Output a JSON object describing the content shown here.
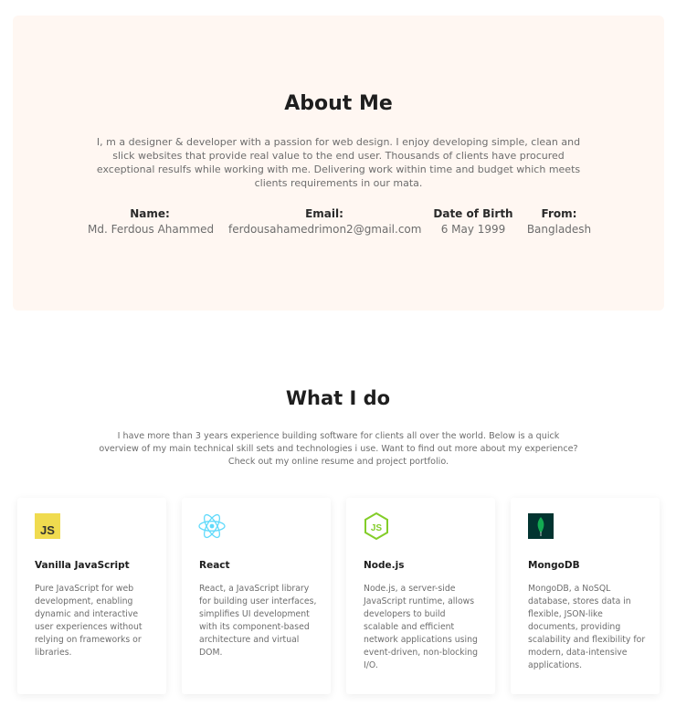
{
  "about": {
    "title": "About Me",
    "description": "I, m a designer & developer with a passion for web design. I enjoy developing simple, clean and slick websites that provide real value to the end user. Thousands of clients have procured exceptional resulfs while working with me. Delivering work within time and budget which meets clients requirements in our mata.",
    "info": [
      {
        "label": "Name:",
        "value": "Md. Ferdous Ahammed"
      },
      {
        "label": "Email:",
        "value": "ferdousahamedrimon2@gmail.com"
      },
      {
        "label": "Date of Birth",
        "value": "6 May 1999"
      },
      {
        "label": "From:",
        "value": "Bangladesh"
      }
    ]
  },
  "services": {
    "title": "What I do",
    "description": "I have more than 3 years experience building software for clients all over the world. Below is a quick overview of my main technical skill sets and technologies i use. Want to find out more about my experience? Check out my online resume and project portfolio.",
    "cards": [
      {
        "icon": "javascript-icon",
        "icon_text": "JS",
        "title": "Vanilla JavaScript",
        "description": "Pure JavaScript for web development, enabling dynamic and interactive user experiences without relying on frameworks or libraries."
      },
      {
        "icon": "react-icon",
        "title": "React",
        "description": "React, a JavaScript library for building user interfaces, simplifies UI development with its component-based architecture and virtual DOM."
      },
      {
        "icon": "nodejs-icon",
        "icon_text": "JS",
        "title": "Node.js",
        "description": "Node.js, a server-side JavaScript runtime, allows developers to build scalable and efficient network applications using event-driven, non-blocking I/O."
      },
      {
        "icon": "mongodb-icon",
        "title": "MongoDB",
        "description": "MongoDB, a NoSQL database, stores data in flexible, JSON-like documents, providing scalability and flexibility for modern, data-intensive applications."
      }
    ]
  },
  "colors": {
    "about_bg": "#fff7f2",
    "js_yellow": "#f0db4f",
    "react_blue": "#61dafb",
    "node_green": "#83cd29",
    "mongo_bg": "#023430",
    "mongo_leaf": "#13aa52"
  }
}
